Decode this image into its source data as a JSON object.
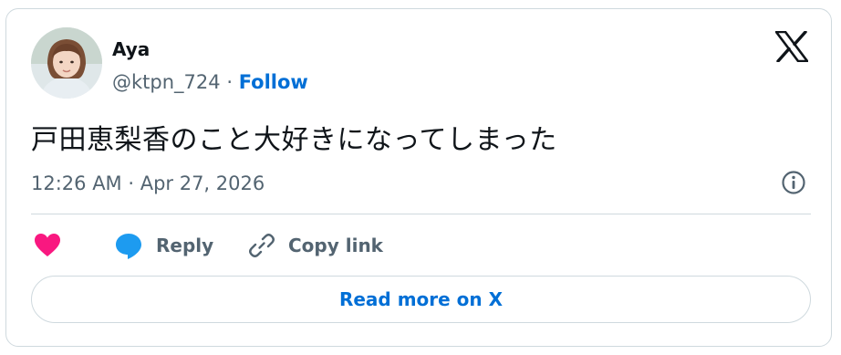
{
  "author": {
    "name": "Aya",
    "handle": "@ktpn_724",
    "separator": "·",
    "follow_label": "Follow"
  },
  "tweet": {
    "text": "戸田恵梨香のこと大好きになってしまった",
    "timestamp": "12:26 AM · Apr 27, 2026"
  },
  "actions": {
    "reply_label": "Reply",
    "copy_link_label": "Copy link"
  },
  "read_more_label": "Read more on X",
  "icons": {
    "logo": "x-logo-icon",
    "info": "info-icon",
    "like": "heart-icon",
    "reply": "speech-bubble-icon",
    "copy": "link-icon"
  },
  "colors": {
    "accent": "#006fd6",
    "heart": "#f91880",
    "reply_bubble": "#1d9bf0",
    "muted": "#536471",
    "border": "#cfd9de"
  }
}
